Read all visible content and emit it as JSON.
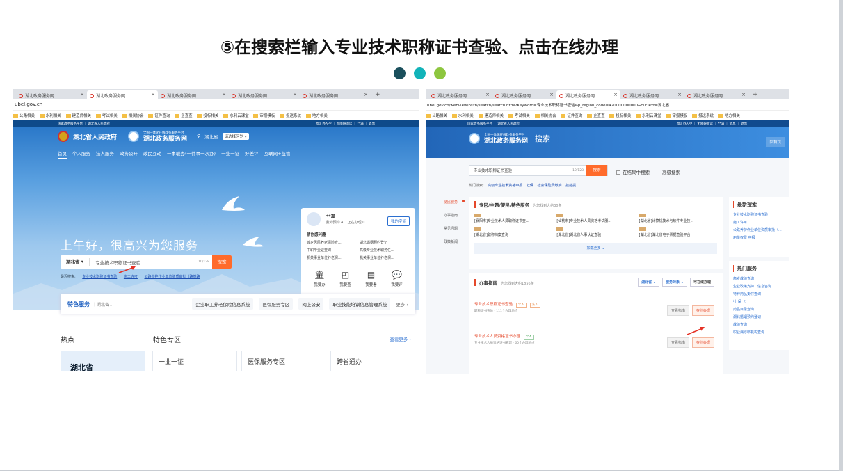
{
  "slide": {
    "title": "⑤在搜索栏输入专业技术职称证书查验、点击在线办理",
    "dot_colors": [
      "#1a4f5c",
      "#12b3b9",
      "#8dc63f"
    ]
  },
  "left": {
    "tabs": [
      "湖北政务服务网",
      "湖北政务服务网",
      "湖北政务服务网",
      "湖北政务服务网",
      "湖北政务服务网"
    ],
    "url": "ubel.gov.cn",
    "bookmarks": [
      "公路相关",
      "水利相关",
      "建造师相关",
      "考试相关",
      "相关协会",
      "证件查询",
      "企查查",
      "投标相关",
      "水利云课堂",
      "审报模板",
      "报送系统",
      "地方相关"
    ],
    "top_bar": {
      "left": "国家政务服务平台 ｜ 湖北省人民政府",
      "right": "鄂汇办APP ｜ 无障碍阅读 ｜ **满 ｜ 退出"
    },
    "gov_name": "湖北省人民政府",
    "service_name": "湖北政务服务网",
    "service_sub": "全国一体化在线政务服务平台",
    "location": "湖北省",
    "region_button": "请选择区划",
    "nav": [
      "首页",
      "个人服务",
      "法人服务",
      "政务公开",
      "政民互动",
      "一事联办(一件事一次办)",
      "一业一证",
      "好差评",
      "互联网+监管"
    ],
    "greeting": "上午好，很高兴为您服务",
    "search": {
      "region": "湖北省",
      "query": "专业技术职称证书查验",
      "count": "10/128",
      "button": "搜索"
    },
    "recent": {
      "label": "最近搜索:",
      "items": [
        "专业技术职称证书查验",
        "施工许可",
        "公路养护作业单位资质审批（路基路"
      ]
    },
    "profile": {
      "name": "**满",
      "my_todo": "我的预约 4",
      "doing": "正在办理 0",
      "space_button": "我的空间",
      "interest_title": "猜你感兴趣",
      "interests": [
        "城乡居民养老保险查...",
        "湖北婚姻预约登记",
        "中职毕业证查询",
        "高级专业技术职务任...",
        "机关事业单位养老保...",
        "机关事业单位养老保..."
      ],
      "actions": [
        {
          "icon": "🏛",
          "label": "我要办"
        },
        {
          "icon": "◰",
          "label": "我要查"
        },
        {
          "icon": "▤",
          "label": "我要看"
        },
        {
          "icon": "💬",
          "label": "我要评"
        }
      ]
    },
    "featured": {
      "label": "特色服务",
      "region": "湖北省",
      "systems": [
        "企业职工养老保险信息系统",
        "医保服务专区",
        "网上公安",
        "职业技能培训信息管理系统"
      ],
      "more": "更多"
    },
    "bottom": {
      "hot": "热点",
      "special": "特色专区",
      "more": "查看更多 ›",
      "hot_card": "湖北省",
      "cards": [
        "一业一证",
        "医保服务专区",
        "跨省通办"
      ]
    }
  },
  "right": {
    "tabs": [
      "湖北政务服务网",
      "湖北政务服务网",
      "湖北政务服务网",
      "湖北政务服务网",
      "湖北政务服务网"
    ],
    "url": "ubel.gov.cn/webview/bszn/search/search.html?Keyword=专业技术职称证书查验&p_region_code=420000000000&curText=湖北省",
    "bookmarks": [
      "公路相关",
      "水利相关",
      "建造师相关",
      "考试相关",
      "相关协会",
      "证件查询",
      "企查查",
      "投标相关",
      "水利云课堂",
      "审报模板",
      "报送系统",
      "地方相关"
    ],
    "top_bar": {
      "left": "国家政务服务平台 ｜ 湖北省人民政府",
      "right": "鄂汇办APP ｜ 无障碍阅读 ｜ **满 ｜ 消息 ｜ 退出"
    },
    "service_name": "湖北政务服务网",
    "service_sub": "全国一体化在线政务服务平台",
    "section": "搜索",
    "home": "回首页",
    "search": {
      "query": "专业技术职称证书查验",
      "count": "10/128",
      "button": "搜索",
      "within": "在结果中搜索",
      "advanced": "高级搜索"
    },
    "hot": {
      "label": "热门搜索:",
      "items": [
        "高级专业技术资格申报",
        "社保",
        "社会保险费缴纳",
        "技能提..."
      ]
    },
    "side": [
      "便民服务",
      "办事指南",
      "常见问题",
      "政策新闻"
    ],
    "zones": {
      "title": "专区/主题/便民/特色服务",
      "count": "为您找到大约30条",
      "items": [
        "[襄阳市]专业技术人员职称证书查...",
        "[仙桃市]专业技术人员资格考试服...",
        "[湖北省]计算机技术与软件专业技...",
        "[湖北省]职称档案查询",
        "[湖北省]湖北省人事认证查验",
        "[湖北省]湖北省电子票据查验平台"
      ],
      "load_more": "加载更多 ⌄"
    },
    "guide": {
      "title": "办事指南",
      "count": "为您找到大约1856条",
      "filters": [
        "湖北省 ⌄",
        "服务对象 ⌄",
        "可在线办理"
      ],
      "items": [
        {
          "title": "专业技术职称证书查验",
          "tags": [
            "个人",
            "法人"
          ],
          "desc": "职称证书查验 · 111个办理地点",
          "buttons": [
            "查看指南",
            "在线办理"
          ]
        },
        {
          "title": "专业技术人员资格证书办理",
          "tags": [
            "个人"
          ],
          "desc": "专业技术人员资格证书管理 · 60个办理地点",
          "buttons": [
            "查看指南",
            "在线办理"
          ]
        }
      ]
    },
    "latest": {
      "title": "最新搜索",
      "items": [
        "专业技术职称证书查验",
        "施工许可",
        "公路养护作业单位资质审批（...",
        "用能权费 申报"
      ]
    },
    "hot_services": {
      "title": "热门服务",
      "items": [
        "高考成绩查询",
        "企业政策支持、信息咨询",
        "特种药品支付查询",
        "社 保 卡",
        "药品目录查询",
        "湖北婚姻预约登记",
        "成绩查询",
        "职业病诊断机构查询"
      ]
    }
  }
}
